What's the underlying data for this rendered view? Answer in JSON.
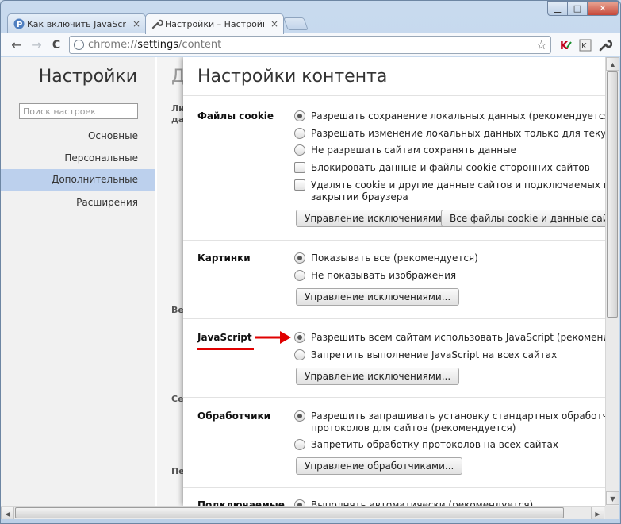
{
  "window_controls": {
    "minimize": "▁",
    "maximize": "□",
    "close": "✕"
  },
  "tabs": [
    {
      "title": "Как включить JavaScript в ",
      "close": "×",
      "icon": "letter-p-icon",
      "active": false
    },
    {
      "title": "Настройки – Настройки ко",
      "close": "×",
      "icon": "wrench-icon",
      "active": true
    }
  ],
  "toolbar": {
    "back": "←",
    "forward": "→",
    "reload": "C",
    "url_scheme": "chrome://",
    "url_host": "settings",
    "url_path": "/content",
    "star": "☆",
    "extensions": [
      "kaspersky-icon",
      "extension-icon",
      "wrench-icon"
    ]
  },
  "sidebar": {
    "title": "Настройки",
    "search_placeholder": "Поиск настроек",
    "items": [
      {
        "label": "Основные",
        "selected": false
      },
      {
        "label": "Персональные",
        "selected": false
      },
      {
        "label": "Дополнительные",
        "selected": true
      },
      {
        "label": "Расширения",
        "selected": false
      }
    ]
  },
  "background_page": {
    "title_fragment": "Д",
    "fragments": [
      "Ли",
      "да",
      "Ве",
      "Се",
      "Пе"
    ]
  },
  "content_settings": {
    "title": "Настройки контента",
    "cookies": {
      "heading": "Файлы cookie",
      "options": [
        {
          "type": "radio",
          "checked": true,
          "label": "Разрешать сохранение локальных данных (рекомендуется)"
        },
        {
          "type": "radio",
          "checked": false,
          "label": "Разрешать изменение локальных данных только для текущего сеанса"
        },
        {
          "type": "radio",
          "checked": false,
          "label": "Не разрешать сайтам сохранять данные"
        },
        {
          "type": "checkbox",
          "checked": false,
          "label": "Блокировать данные и файлы cookie сторонних сайтов"
        },
        {
          "type": "checkbox",
          "checked": false,
          "label": "Удалять cookie и другие данные сайтов и подключаемых модулей при",
          "label2": "закрытии браузера"
        }
      ],
      "buttons": [
        "Управление исключениями...",
        "Все файлы cookie и данные сайтов..."
      ]
    },
    "images": {
      "heading": "Картинки",
      "options": [
        {
          "type": "radio",
          "checked": true,
          "label": "Показывать все (рекомендуется)"
        },
        {
          "type": "radio",
          "checked": false,
          "label": "Не показывать изображения"
        }
      ],
      "button": "Управление исключениями..."
    },
    "javascript": {
      "heading": "JavaScript",
      "options": [
        {
          "type": "radio",
          "checked": true,
          "label": "Разрешить всем сайтам использовать JavaScript (рекомендуется)"
        },
        {
          "type": "radio",
          "checked": false,
          "label": "Запретить выполнение JavaScript на всех сайтах"
        }
      ],
      "button": "Управление исключениями...",
      "annotation_color": "#e00000"
    },
    "handlers": {
      "heading": "Обработчики",
      "options": [
        {
          "type": "radio",
          "checked": true,
          "label": "Разрешить запрашивать установку стандартных обработчиков",
          "label2": "протоколов для сайтов (рекомендуется)"
        },
        {
          "type": "radio",
          "checked": false,
          "label": "Запретить обработку протоколов на всех сайтах"
        }
      ],
      "button": "Управление обработчиками..."
    },
    "plugins": {
      "heading": "Подключаемые",
      "first_option": "Выполнять автоматически (рекомендуется)"
    }
  },
  "scrollbars": {
    "up": "▲",
    "down": "▼",
    "left": "◀",
    "right": "▶"
  }
}
